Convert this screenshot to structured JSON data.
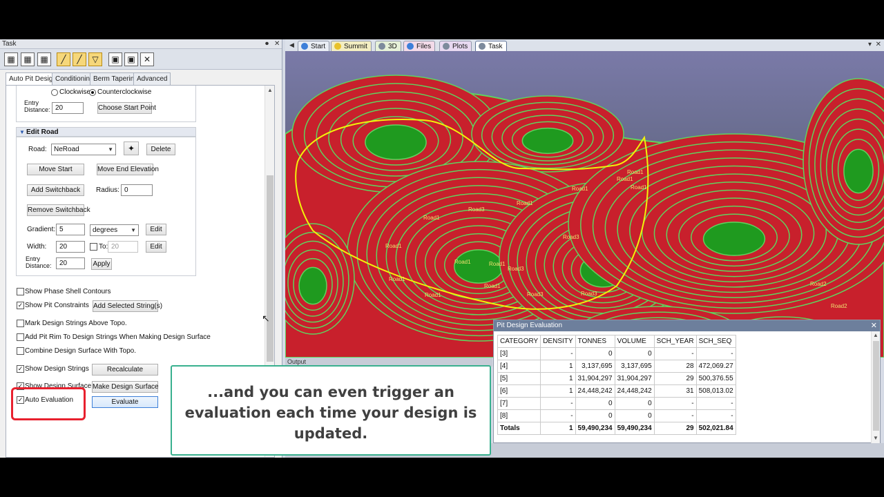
{
  "task_panel": {
    "title": "Task",
    "pin": "⌕",
    "close": "✕",
    "tabs": [
      "Auto Pit Design",
      "Conditioning",
      "Berm Tapering",
      "Advanced"
    ],
    "direction": {
      "clockwise": "Clockwise",
      "counterclockwise": "Counterclockwise",
      "selected": "Counterclockwise"
    },
    "entry_distance_label_1": "Entry",
    "entry_distance_label_2": "Distance:",
    "entry_distance_value": "20",
    "choose_start_point": "Choose Start Point",
    "edit_road": {
      "header": "Edit Road",
      "road_label": "Road:",
      "road_value": "NeRoad",
      "delete": "Delete",
      "move_start": "Move Start",
      "move_end_elevation": "Move End Elevation",
      "add_switchback": "Add Switchback",
      "radius_label": "Radius:",
      "radius_value": "0",
      "remove_switchback": "Remove Switchback",
      "gradient_label": "Gradient:",
      "gradient_value": "5",
      "gradient_unit": "degrees",
      "edit": "Edit",
      "width_label": "Width:",
      "width_value": "20",
      "to_label": "To:",
      "to_value": "20",
      "entry_distance_value": "20",
      "apply": "Apply"
    },
    "options": {
      "show_phase_shell_contours": "Show Phase Shell Contours",
      "show_pit_constraints": "Show Pit Constraints",
      "add_selected_strings": "Add Selected String(s)",
      "mark_design_strings": "Mark Design Strings Above Topo.",
      "add_pit_rim": "Add Pit Rim To Design Strings When Making Design Surface",
      "combine_design_surface": "Combine Design Surface With Topo.",
      "show_design_strings": "Show Design Strings",
      "recalculate": "Recalculate",
      "show_design_surface": "Show Design Surface",
      "make_design_surface": "Make Design Surface",
      "auto_evaluation": "Auto Evaluation",
      "evaluate": "Evaluate"
    }
  },
  "view_tabs": [
    {
      "label": "Start",
      "color": "#3d7fd9"
    },
    {
      "label": "Summit",
      "color": "#e8c12a"
    },
    {
      "label": "3D",
      "color": "#7d8a9c"
    },
    {
      "label": "Files",
      "color": "#3d7fd9"
    },
    {
      "label": "Plots",
      "color": "#7d8a9c"
    },
    {
      "label": "Task",
      "color": "#7d8a9c"
    }
  ],
  "viewport": {
    "road_labels": [
      "Road1",
      "Road1",
      "Road1",
      "Road1",
      "Road1",
      "Road1",
      "Road1",
      "Road1",
      "Road1",
      "Road1",
      "Road1",
      "Road1",
      "Road3",
      "Road3",
      "Road3",
      "Road3",
      "Road3",
      "Road2",
      "Road2",
      "Road2"
    ],
    "colors": {
      "bench": "#c8202c",
      "floor": "#1f9a1f",
      "crest": "#5fd45f",
      "design_string": "#f2f20a",
      "sky_top": "#7a7aa8",
      "sky_bottom": "#2b3440"
    }
  },
  "output_label": "Output",
  "evaluation": {
    "title": "Pit Design Evaluation",
    "close": "✕",
    "columns": [
      "CATEGORY",
      "DENSITY",
      "TONNES",
      "VOLUME",
      "SCH_YEAR",
      "SCH_SEQ"
    ],
    "rows": [
      [
        "[3]",
        "-",
        "0",
        "0",
        "-",
        "-"
      ],
      [
        "[4]",
        "1",
        "3,137,695",
        "3,137,695",
        "28",
        "472,069.27"
      ],
      [
        "[5]",
        "1",
        "31,904,297",
        "31,904,297",
        "29",
        "500,376.55"
      ],
      [
        "[6]",
        "1",
        "24,448,242",
        "24,448,242",
        "31",
        "508,013.02"
      ],
      [
        "[7]",
        "-",
        "0",
        "0",
        "-",
        "-"
      ],
      [
        "[8]",
        "-",
        "0",
        "0",
        "-",
        "-"
      ]
    ],
    "totals": [
      "Totals",
      "1",
      "59,490,234",
      "59,490,234",
      "29",
      "502,021.84"
    ]
  },
  "caption": {
    "line1": "...and you can even trigger an",
    "line2": "evaluation each time your design is",
    "line3": "updated."
  }
}
